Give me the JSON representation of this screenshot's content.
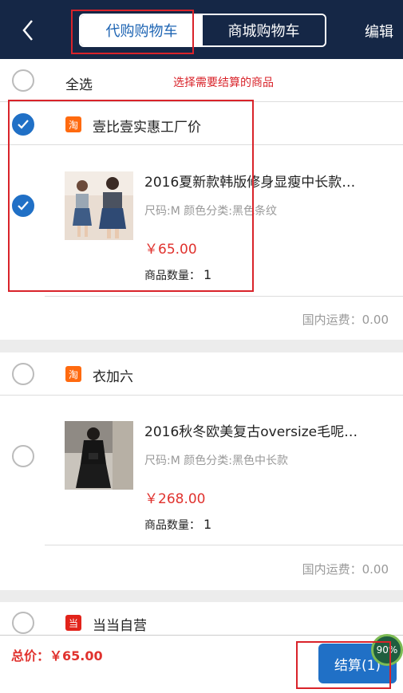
{
  "header": {
    "tabs": [
      {
        "label": "代购购物车",
        "active": true
      },
      {
        "label": "商城购物车",
        "active": false
      }
    ],
    "edit_label": "编辑"
  },
  "select_all": {
    "label": "全选",
    "hint": "选择需要结算的商品"
  },
  "stores": [
    {
      "name": "壹比壹实惠工厂价",
      "icon": "taobao-icon",
      "icon_text": "淘",
      "checked": true,
      "item": {
        "title": "2016夏新款韩版修身显瘦中长款…",
        "spec": "尺码:M 颜色分类:黑色条纹",
        "price": "￥65.00",
        "qty_label": "商品数量：",
        "qty": "1",
        "checked": true
      },
      "shipping": "国内运费：0.00"
    },
    {
      "name": "衣加六",
      "icon": "taobao-icon",
      "icon_text": "淘",
      "checked": false,
      "item": {
        "title": "2016秋冬欧美复古oversize毛呢…",
        "spec": "尺码:M 颜色分类:黑色中长款",
        "price": "￥268.00",
        "qty_label": "商品数量：",
        "qty": "1",
        "checked": false
      },
      "shipping": "国内运费：0.00"
    },
    {
      "name": "当当自营",
      "icon": "dangdang-icon",
      "icon_text": "当",
      "checked": false
    }
  ],
  "footer": {
    "total": "总价：￥65.00",
    "checkout": "结算(1)",
    "badge": "90%"
  },
  "colors": {
    "header_bg": "#152746",
    "accent": "#2070c6",
    "price": "#e0322e",
    "annotation": "#d9232a"
  }
}
